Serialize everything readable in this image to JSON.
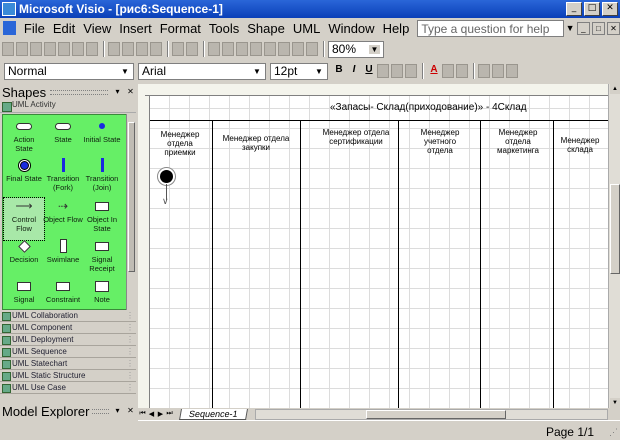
{
  "window": {
    "title": "Microsoft Visio - [рис6:Sequence-1]",
    "minimize": "_",
    "maximize": "□",
    "close": "✕"
  },
  "menu": {
    "items": [
      "File",
      "Edit",
      "View",
      "Insert",
      "Format",
      "Tools",
      "Shape",
      "UML",
      "Window",
      "Help"
    ],
    "help_placeholder": "Type a question for help",
    "mdi_controls": [
      "_",
      "□",
      "✕"
    ]
  },
  "toolbar": {
    "zoom": "80%"
  },
  "format_toolbar": {
    "style": "Normal",
    "font": "Arial",
    "size": "12pt",
    "bold": "B",
    "italic": "I",
    "underline": "U",
    "font_color_glyph": "A"
  },
  "shapes_panel": {
    "title": "Shapes",
    "active_stencil": "UML Activity",
    "shapes": [
      {
        "label": "Action State",
        "icon": "rounded-rect-icon"
      },
      {
        "label": "State",
        "icon": "rounded-rect-icon"
      },
      {
        "label": "Initial State",
        "icon": "filled-dot-icon"
      },
      {
        "label": "Final State",
        "icon": "final-state-icon"
      },
      {
        "label": "Transition (Fork)",
        "icon": "fork-bar-icon"
      },
      {
        "label": "Transition (Join)",
        "icon": "join-bar-icon"
      },
      {
        "label": "Control Flow",
        "icon": "arrow-icon"
      },
      {
        "label": "Object Flow",
        "icon": "dashed-arrow-icon"
      },
      {
        "label": "Object In State",
        "icon": "object-icon"
      },
      {
        "label": "Decision",
        "icon": "diamond-icon"
      },
      {
        "label": "Swimlane",
        "icon": "swimlane-icon"
      },
      {
        "label": "Signal Receipt",
        "icon": "signal-receipt-icon"
      },
      {
        "label": "Signal",
        "icon": "signal-icon"
      },
      {
        "label": "Constraint",
        "icon": "constraint-icon"
      },
      {
        "label": "Note",
        "icon": "note-icon"
      }
    ],
    "stencils": [
      "UML Collaboration",
      "UML Component",
      "UML Deployment",
      "UML Sequence",
      "UML Statechart",
      "UML Static Structure",
      "UML Use Case"
    ],
    "explorer_title": "Model Explorer"
  },
  "diagram": {
    "header": "«Запасы- Склад(приходование)» - 4Склад",
    "lanes": [
      "Менеджер отдела приемки",
      "Менеджер отдела закупки",
      "Менеджер отдела сертификации",
      "Менеджер учетного отдела",
      "Менеджер отдела маркетинга",
      "Менеджер склада"
    ]
  },
  "page_tabs": {
    "active": "Sequence-1"
  },
  "status": {
    "page": "Page 1/1"
  },
  "colors": {
    "stencil_bg": "#66ef66",
    "titlebar": "#0a3fb8"
  }
}
